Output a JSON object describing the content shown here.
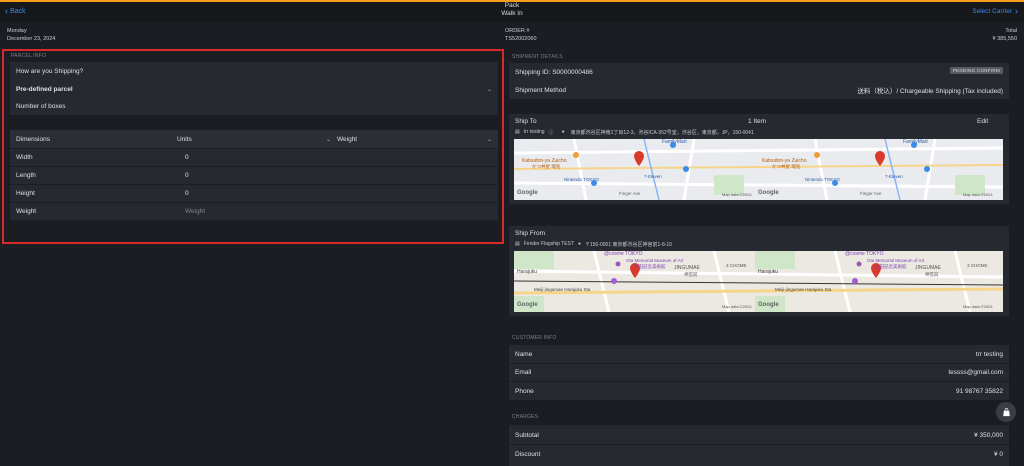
{
  "topbar": {
    "back_label": "Back",
    "title": "Pack",
    "subtitle": "Walk In",
    "select_carrier_label": "Select Carrier"
  },
  "info": {
    "day": "Monday",
    "date": "December 23, 2024",
    "order_label": "ORDER #",
    "order_number": "TS52002060",
    "total_label": "Total",
    "total_value": "¥ 385,550"
  },
  "parcel_info": {
    "section_title": "PARCEL INFO",
    "question": "How are you Shipping?",
    "parcel_type": "Pre-defined parcel",
    "boxes_label": "Number of boxes",
    "dimensions_header": "Dimensions",
    "units_header": "Units",
    "weight_header": "Weight",
    "rows": [
      {
        "label": "Width",
        "value": "0"
      },
      {
        "label": "Length",
        "value": "0"
      },
      {
        "label": "Height",
        "value": "0"
      }
    ],
    "weight_row_label": "Weight",
    "weight_placeholder": "Weight"
  },
  "shipment_details": {
    "section_title": "SHIPMENT DETAILS",
    "shipping_id": "Shipping ID: S0000000486",
    "status_badge": "PENDING CONFIRM",
    "method_label": "Shipment Method",
    "method_value": "送料（税込）/ Chargeable Shipping (Tax included)"
  },
  "ship_to": {
    "title": "Ship To",
    "count": "1 Item",
    "edit_label": "Edit",
    "name": "trr testing",
    "address": "東京都渋谷区神南1丁目12-3，渋谷ICA-352号室，渋谷区，東京都，JP，150-0041",
    "map_labels": [
      "Katsudon-ya Zuicho",
      "かつ丼屋 瑞兆",
      "FamilyMart",
      "Nintendo TOKYO",
      "7-Eleven",
      "Finger Ave",
      "Google",
      "Map data ©2024"
    ]
  },
  "ship_from": {
    "title": "Ship From",
    "name": "Fender Flagship TEST",
    "address": "〒150-0001 東京都渋谷区神宮前1-8-10",
    "map_labels": [
      "@cosme TOKYO",
      "Ota Memorial Museum of Art",
      "太田記念美術館",
      "Harajuku",
      "JINGUMAE",
      "神宮前",
      "3 CHOME",
      "Meiji-jingumae Harajuku Sta",
      "Google",
      "Map data ©2024"
    ]
  },
  "customer_info": {
    "section_title": "CUSTOMER INFO",
    "name_label": "Name",
    "name_value": "trr testing",
    "email_label": "Email",
    "email_value": "tessss@gmail.com",
    "phone_label": "Phone",
    "phone_value": "91 98767 35822"
  },
  "charges": {
    "section_title": "CHARGES",
    "subtotal_label": "Subtotal",
    "subtotal_value": "¥ 350,000",
    "discount_label": "Discount",
    "discount_value": "¥ 0"
  },
  "colors": {
    "accent": "#3b8bea",
    "highlight_border": "#d72a2a",
    "top_stripe": "#f5a019",
    "map_pin": "#d93a2b"
  }
}
